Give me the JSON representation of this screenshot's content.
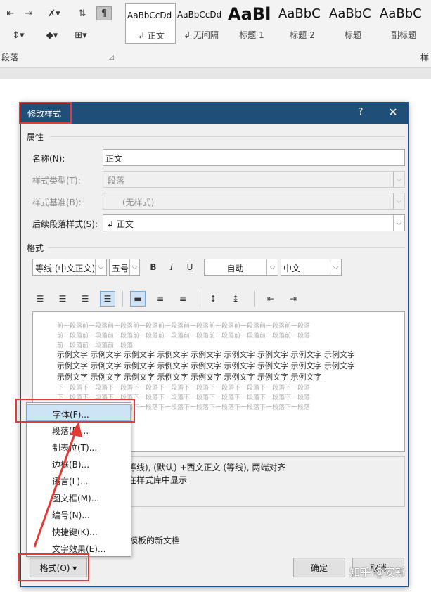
{
  "ribbon": {
    "paragraph_group_label": "段落",
    "right_group_label": "样",
    "styles_gallery": [
      {
        "sample": "AaBbCcDd",
        "name": "↲ 正文",
        "active": true,
        "size": 12,
        "bold": false
      },
      {
        "sample": "AaBbCcDd",
        "name": "↲ 无间隔",
        "active": false,
        "size": 12,
        "bold": false
      },
      {
        "sample": "AaBl",
        "name": "标题 1",
        "active": false,
        "size": 24,
        "bold": true
      },
      {
        "sample": "AaBbC",
        "name": "标题 2",
        "active": false,
        "size": 18,
        "bold": false
      },
      {
        "sample": "AaBbC",
        "name": "标题",
        "active": false,
        "size": 18,
        "bold": false
      },
      {
        "sample": "AaBbC",
        "name": "副标题",
        "active": false,
        "size": 18,
        "bold": false
      }
    ]
  },
  "dialog": {
    "title": "修改样式",
    "help": "?",
    "close": "✕",
    "properties_label": "属性",
    "name_label": "名称(N):",
    "name_value": "正文",
    "style_type_label": "样式类型(T):",
    "style_type_value": "段落",
    "style_based_label": "样式基准(B):",
    "style_based_value": "(无样式)",
    "next_style_label": "后续段落样式(S):",
    "next_style_value": "↲ 正文",
    "format_label": "格式",
    "font_value": "等线 (中文正文)",
    "size_value": "五号",
    "color_value": "自动",
    "lang_value": "中文",
    "preview": {
      "prev_lines": [
        "前一段落前一段落前一段落前一段落前一段落前一段落前一段落前一段落前一段落前一段落",
        "前一段落前一段落前一段落前一段落前一段落前一段落前一段落前一段落前一段落前一段落",
        "前一段落前一段落前一段落"
      ],
      "sample_lines": [
        "示例文字 示例文字 示例文字 示例文字 示例文字 示例文字 示例文字 示例文字 示例文字",
        "示例文字 示例文字 示例文字 示例文字 示例文字 示例文字 示例文字 示例文字 示例文字",
        "示例文字 示例文字 示例文字 示例文字 示例文字 示例文字 示例文字 示例文字"
      ],
      "next_lines": [
        "下一段落下一段落下一段落下一段落下一段落下一段落下一段落下一段落下一段落下一段落",
        "下一段落下一段落下一段落下一段落下一段落下一段落下一段落下一段落下一段落下一段落",
        "下一段落下一段落下一段落下一段落下一段落下一段落下一段落下一段落下一段落下一段落"
      ]
    },
    "description_line1": "等线), (默认) +西文正文 (等线), 两端对齐",
    "description_line2": "在样式库中显示",
    "template_text": "该模板的新文档",
    "format_button": "格式(O) ▾",
    "ok_button": "确定",
    "cancel_button": "取消"
  },
  "format_menu": {
    "items": [
      "字体(F)...",
      "段落(P)...",
      "制表位(T)...",
      "边框(B)...",
      "语言(L)...",
      "图文框(M)...",
      "编号(N)...",
      "快捷键(K)...",
      "文字效果(E)..."
    ]
  },
  "watermark": "知乎 @安新",
  "colors": {
    "dialog_title_bar": "#1f4e79",
    "annotation_red": "#e53935",
    "menu_highlight": "#cde3f6"
  }
}
